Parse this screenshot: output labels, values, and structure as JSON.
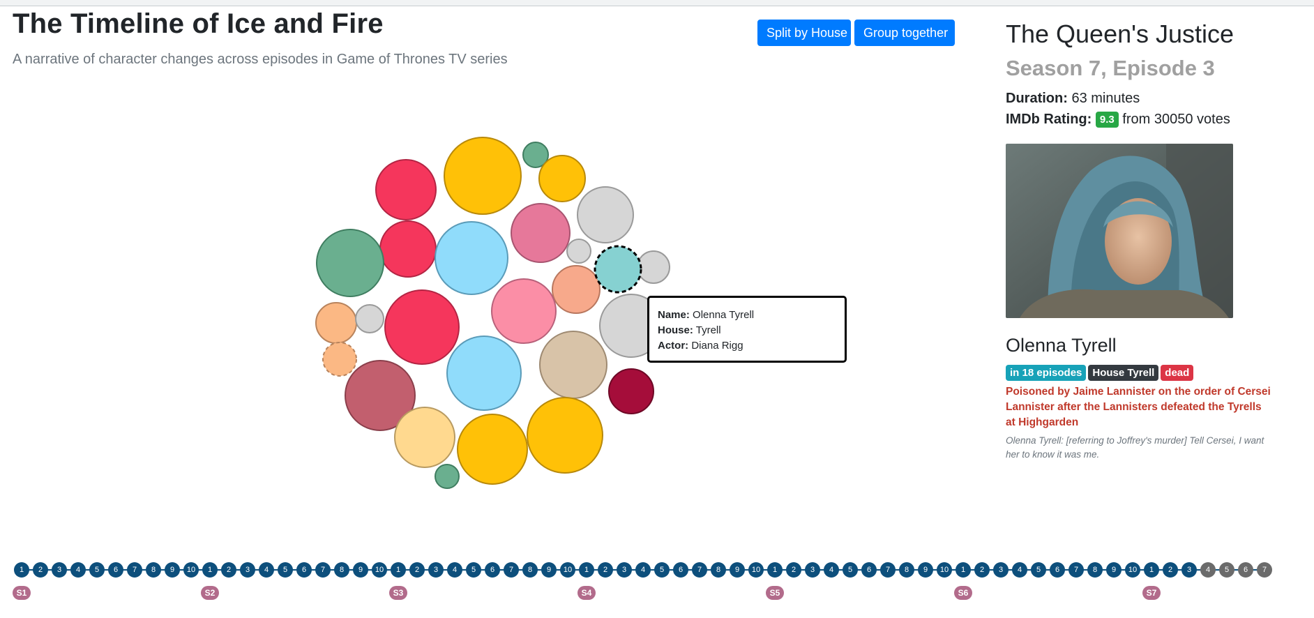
{
  "header": {
    "title": "The Timeline of Ice and Fire",
    "subtitle": "A narrative of character changes across episodes in Game of Thrones TV series",
    "buttons": {
      "split": "Split by House",
      "group": "Group together"
    }
  },
  "episode": {
    "title": "The Queen's Justice",
    "season_episode": "Season 7, Episode 3",
    "duration_label": "Duration:",
    "duration_value": "63 minutes",
    "rating_label": "IMDb Rating:",
    "rating": "9.3",
    "votes_text": "from 30050 votes"
  },
  "character": {
    "name": "Olenna Tyrell",
    "badges": {
      "episodes": "in 18 episodes",
      "house": "House Tyrell",
      "status": "dead"
    },
    "death": "Poisoned by Jaime Lannister on the order of Cersei Lannister after the Lannisters defeated the Tyrells at Highgarden",
    "quote": "Olenna Tyrell: [referring to Joffrey's murder] Tell Cersei, I want her to know it was me."
  },
  "tooltip": {
    "name_label": "Name:",
    "name": "Olenna Tyrell",
    "house_label": "House:",
    "house": "Tyrell",
    "actor_label": "Actor:",
    "actor": "Diana Rigg"
  },
  "colors": {
    "accent": "#007bff",
    "timeline": "#0d4f7c",
    "timeline_future": "#6b6b6b",
    "season_badge": "#b26b8b"
  },
  "timeline": {
    "seasons": [
      {
        "label": "S1",
        "episodes": [
          "1",
          "2",
          "3",
          "4",
          "5",
          "6",
          "7",
          "8",
          "9",
          "10"
        ]
      },
      {
        "label": "S2",
        "episodes": [
          "1",
          "2",
          "3",
          "4",
          "5",
          "6",
          "7",
          "8",
          "9",
          "10"
        ]
      },
      {
        "label": "S3",
        "episodes": [
          "1",
          "2",
          "3",
          "4",
          "5",
          "6",
          "7",
          "8",
          "9",
          "10"
        ]
      },
      {
        "label": "S4",
        "episodes": [
          "1",
          "2",
          "3",
          "4",
          "5",
          "6",
          "7",
          "8",
          "9",
          "10"
        ]
      },
      {
        "label": "S5",
        "episodes": [
          "1",
          "2",
          "3",
          "4",
          "5",
          "6",
          "7",
          "8",
          "9",
          "10"
        ]
      },
      {
        "label": "S6",
        "episodes": [
          "1",
          "2",
          "3",
          "4",
          "5",
          "6",
          "7",
          "8",
          "9",
          "10"
        ]
      },
      {
        "label": "S7",
        "episodes": [
          "1",
          "2",
          "3",
          "4",
          "5",
          "6",
          "7"
        ]
      }
    ],
    "current": {
      "season": 7,
      "episode": 3
    }
  }
}
